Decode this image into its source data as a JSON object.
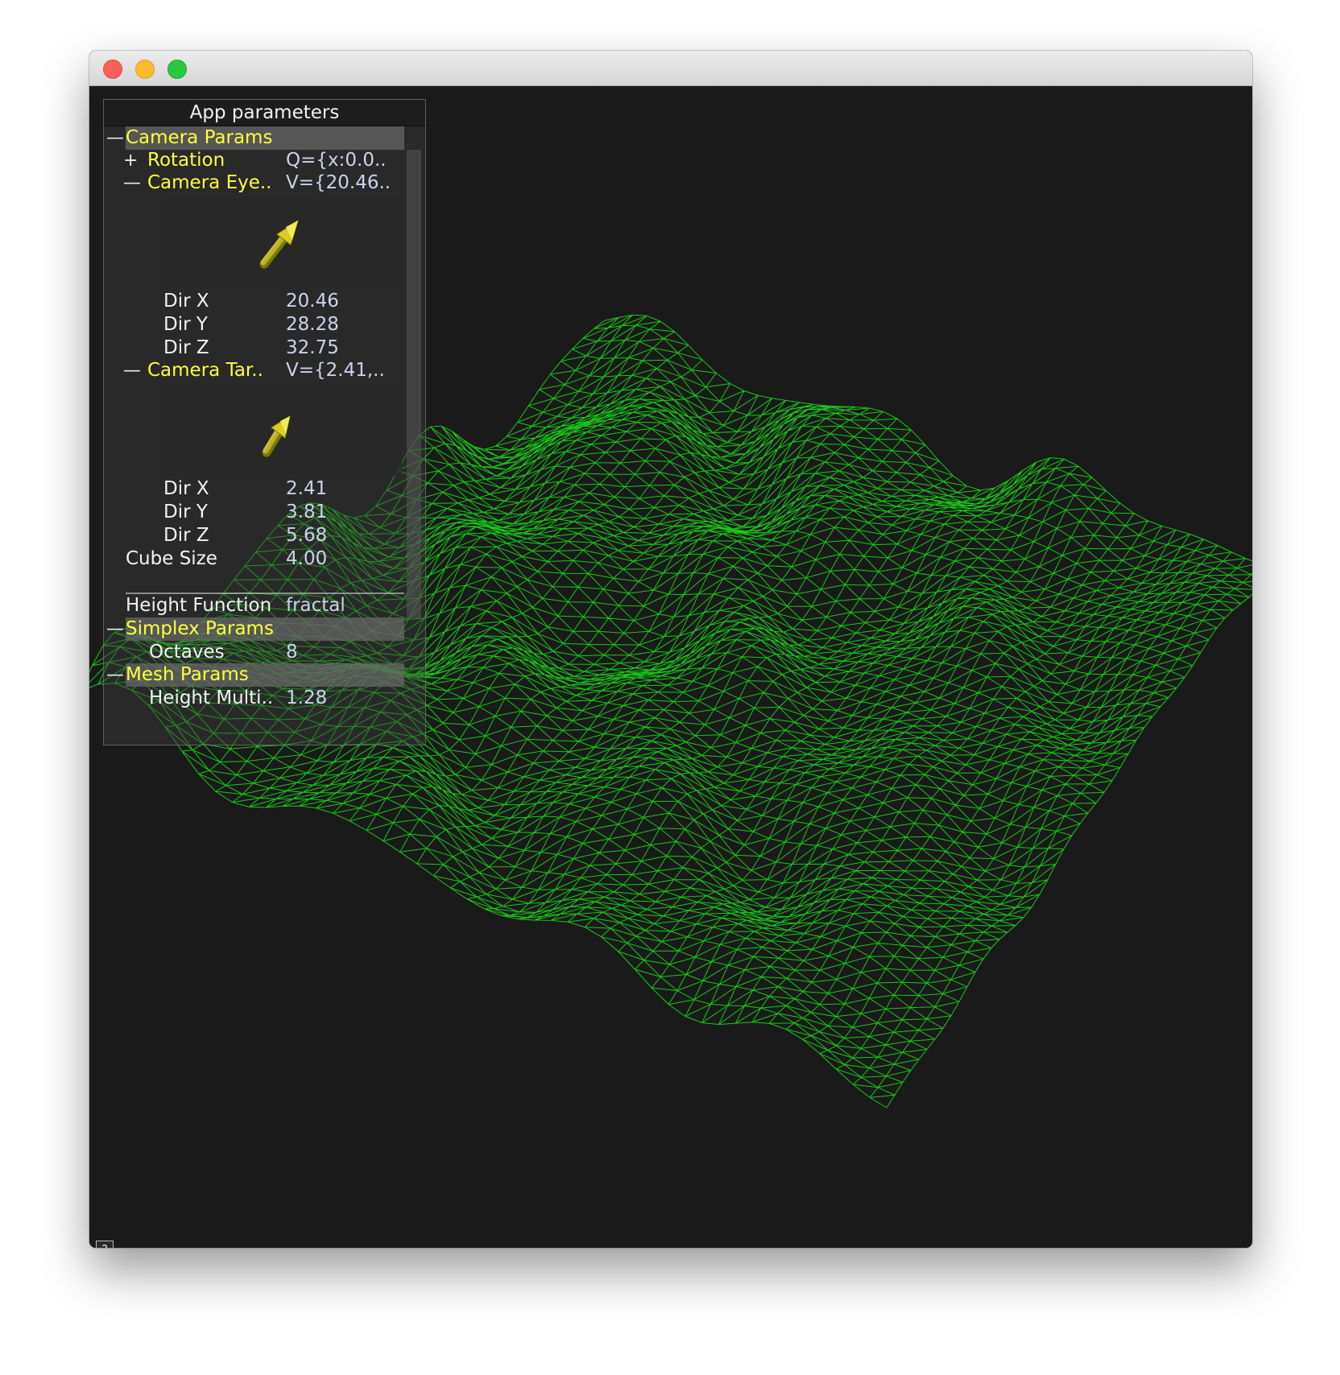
{
  "window": {
    "controls": [
      "close",
      "minimize",
      "zoom"
    ]
  },
  "tweakbar": {
    "title": "App parameters",
    "camera_params": {
      "label": "Camera Params",
      "rotation": {
        "label": "Rotation",
        "value": "Q={x:0.0.."
      },
      "camera_eye": {
        "label": "Camera Eye..",
        "value": "V={20.46..",
        "dir_x": {
          "label": "Dir X",
          "value": "20.46"
        },
        "dir_y": {
          "label": "Dir Y",
          "value": "28.28"
        },
        "dir_z": {
          "label": "Dir Z",
          "value": "32.75"
        }
      },
      "camera_target": {
        "label": "Camera Tar..",
        "value": "V={2.41,..",
        "dir_x": {
          "label": "Dir X",
          "value": "2.41"
        },
        "dir_y": {
          "label": "Dir Y",
          "value": "3.81"
        },
        "dir_z": {
          "label": "Dir Z",
          "value": "5.68"
        }
      },
      "cube_size": {
        "label": "Cube Size",
        "value": "4.00"
      }
    },
    "height_function": {
      "label": "Height Function",
      "value": "fractal"
    },
    "simplex_params": {
      "label": "Simplex Params",
      "octaves": {
        "label": "Octaves",
        "value": "8"
      }
    },
    "mesh_params": {
      "label": "Mesh Params",
      "height_multiplier": {
        "label": "Height Multi..",
        "value": "1.28"
      }
    },
    "toggles": {
      "expanded": "—",
      "collapsed": "+"
    },
    "help_label": "?"
  },
  "colors": {
    "background": "#1a1a1a",
    "wireframe": "#18e618",
    "label_yellow": "#ffff3c",
    "value_blue": "#c9d3ec",
    "arrow_yellow": "#c8c014"
  },
  "icons": [
    "direction-arrow-icon",
    "expand-icon",
    "collapse-icon",
    "help-icon"
  ]
}
